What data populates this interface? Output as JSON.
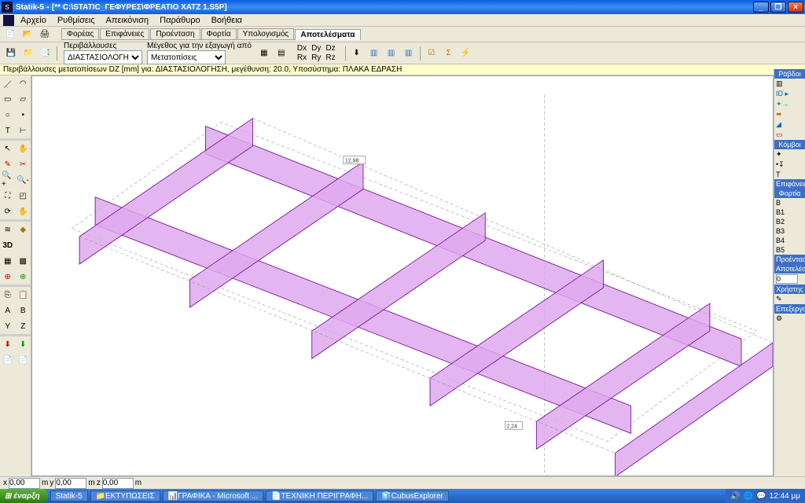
{
  "window": {
    "app_name": "Statik-5",
    "doc_path": "[** C:\\STATIC_ΓΕΦΥΡΕΣ\\ΦΡΕΑΤΙΟ ΧΑΤΖ 1.S5P]",
    "buttons": {
      "min": "_",
      "max": "❐",
      "close": "×"
    }
  },
  "menu": [
    "Αρχείο",
    "Ρυθμίσεις",
    "Απεικόνιση",
    "Παράθυρο",
    "Βοήθεια"
  ],
  "tabs": {
    "items": [
      "Φορέας",
      "Επιφάνειες",
      "Προένταση",
      "Φορτία",
      "Υπολογισμός",
      "Αποτελέσματα"
    ],
    "active": 5
  },
  "params": {
    "label1": "Περιβάλλουσες",
    "combo1": "ΔΙΑΣΤΑΣΙΟΛΟΓΗΣΗ",
    "label2": "Μέγεθος για την εξαγωγή από",
    "combo2": "Μετατοπίσεις",
    "dxyz_top": [
      "Dx",
      "Dy",
      "Dz"
    ],
    "dxyz_bot": [
      "Rx",
      "Ry",
      "Rz"
    ]
  },
  "status_text": "Περιβάλλουσες μετατοπίσεων DZ [mm]  για: ΔΙΑΣΤΑΣΙΟΛΟΓΗΣΗ, μεγέθυνση: 20.0,  Υποσύστημα: ΠΛΑΚΑ ΕΔΡΑΣΗ",
  "coords": {
    "x_label": "x",
    "x_val": "0,00",
    "x_unit": "m",
    "y_label": "y",
    "y_val": "0,00",
    "y_unit": "m",
    "z_label": "z",
    "z_val": "0,00",
    "z_unit": "m"
  },
  "right_panel": {
    "hdr_rabdoi": "Ράβδοι",
    "hdr_komboi": "Κόμβοι",
    "hdr_epifaneies": "Επιφάνειες",
    "hdr_fortia": "Φορτία",
    "fortia_items": [
      "B",
      "B1",
      "B2",
      "B3",
      "B4",
      "B5"
    ],
    "hdr_proentash": "Προένταση",
    "hdr_apotelesmata": "Αποτελέσμ",
    "apotelesmata_val": "0",
    "hdr_xrhsths": "Χρήστης",
    "hdr_epeksergasia": "Επεξεργασ"
  },
  "annotations": {
    "top_val": "12,98",
    "bot_val": "2,24"
  },
  "taskbar": {
    "start": "έναρξη",
    "tasks": [
      "Statik-5",
      "ΕΚΤΥΠΩΣΕΙΣ",
      "ΓΡΑΦΙΚΑ - Microsoft ...",
      "ΤΕΧΝΙΚΗ ΠΕΡΙΓΡΑΦΗ...",
      "CubusExplorer"
    ],
    "time": "12:44 μμ"
  }
}
